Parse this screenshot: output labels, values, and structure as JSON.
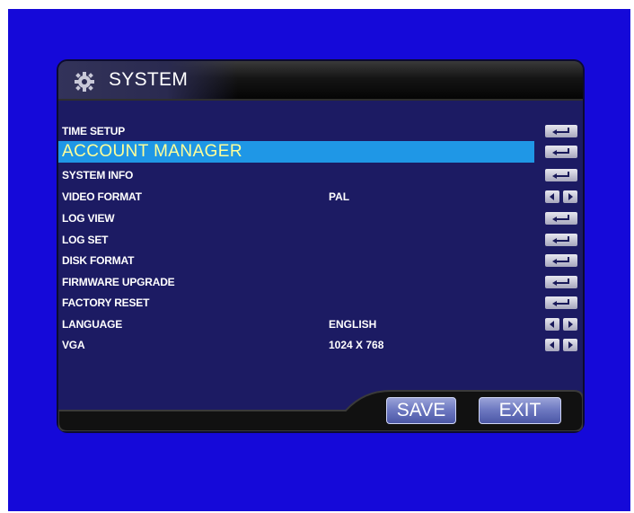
{
  "window": {
    "title": "SYSTEM",
    "title_icon": "gear-icon"
  },
  "menu": {
    "items": [
      {
        "label": "TIME SETUP",
        "value": "",
        "control": "enter"
      },
      {
        "label": "ACCOUNT  MANAGER",
        "value": "",
        "control": "enter",
        "selected": true
      },
      {
        "label": "SYSTEM INFO",
        "value": "",
        "control": "enter"
      },
      {
        "label": "VIDEO FORMAT",
        "value": "PAL",
        "control": "arrows"
      },
      {
        "label": "LOG VIEW",
        "value": "",
        "control": "enter"
      },
      {
        "label": "LOG SET",
        "value": "",
        "control": "enter"
      },
      {
        "label": "DISK FORMAT",
        "value": "",
        "control": "enter"
      },
      {
        "label": "FIRMWARE UPGRADE",
        "value": "",
        "control": "enter"
      },
      {
        "label": "FACTORY RESET",
        "value": "",
        "control": "enter"
      },
      {
        "label": "LANGUAGE",
        "value": "ENGLISH",
        "control": "arrows"
      },
      {
        "label": "VGA",
        "value": "1024 X 768",
        "control": "arrows"
      }
    ]
  },
  "footer": {
    "save_label": "SAVE",
    "exit_label": "EXIT"
  },
  "colors": {
    "background": "#1509d9",
    "panel": "#1c1b63",
    "selection": "#1f97e6",
    "selected_text": "#ffff99"
  }
}
